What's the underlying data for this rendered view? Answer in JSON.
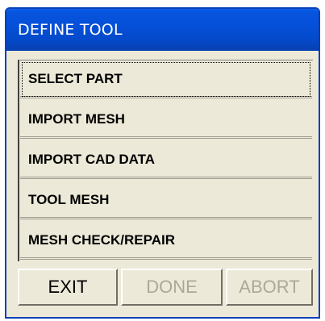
{
  "window": {
    "title": "DEFINE TOOL"
  },
  "menu": {
    "items": [
      {
        "label": "SELECT PART",
        "selected": true
      },
      {
        "label": "IMPORT MESH",
        "selected": false
      },
      {
        "label": "IMPORT CAD DATA",
        "selected": false
      },
      {
        "label": "TOOL MESH",
        "selected": false
      },
      {
        "label": "MESH  CHECK/REPAIR",
        "selected": false
      }
    ]
  },
  "buttons": {
    "exit": {
      "label": "EXIT",
      "enabled": true
    },
    "done": {
      "label": "DONE",
      "enabled": false
    },
    "abort": {
      "label": "ABORT",
      "enabled": false
    }
  },
  "colors": {
    "titlebar": "#0550d8",
    "title_text": "#ffffff",
    "panel_bg": "#ece9d8",
    "disabled_text": "#aca899"
  }
}
